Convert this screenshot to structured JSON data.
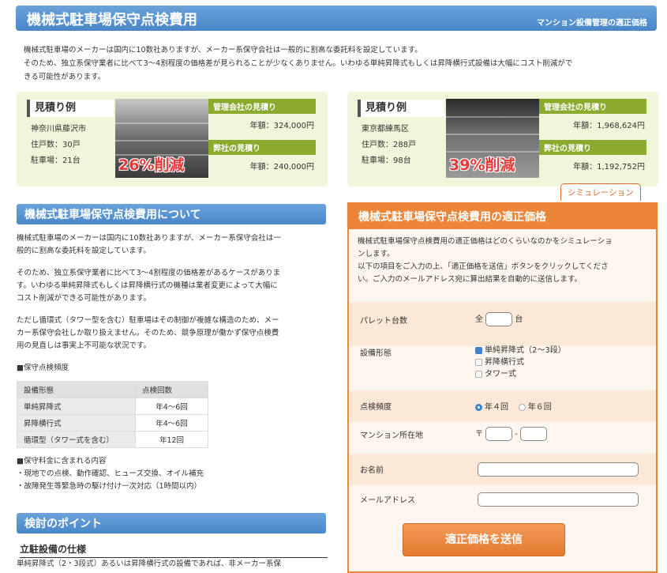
{
  "header": {
    "title": "機械式駐車場保守点検費用",
    "tag": "マンション設備管理の適正価格"
  },
  "intro": {
    "line1": "機械式駐車場のメーカーは国内に10数社ありますが、メーカー系保守会社は一般的に割高な委託料を設定しています。",
    "line2": "そのため、独立系保守業者に比べて3～4割程度の価格差が見られることが少なくありません。いわゆる単純昇降式もしくは昇降横行式設備は大幅にコスト削減がで",
    "line3": "きる可能性があります。"
  },
  "estimates": [
    {
      "label": "見積り例",
      "location": "神奈川県藤沢市",
      "units": "住戸数：30戸",
      "parking": "駐車場：21台",
      "cut": "26%削減",
      "mgmt_tag": "管理会社の見積り",
      "mgmt_amount": "年額：324,000円",
      "ours_tag": "弊社の見積り",
      "ours_amount": "年額：240,000円"
    },
    {
      "label": "見積り例",
      "location": "東京都練馬区",
      "units": "住戸数：288戸",
      "parking": "駐車場：98台",
      "cut": "39%削減",
      "mgmt_tag": "管理会社の見積り",
      "mgmt_amount": "年額：1,968,624円",
      "ours_tag": "弊社の見積り",
      "ours_amount": "年額：1,192,752円"
    }
  ],
  "about": {
    "title": "機械式駐車場保守点検費用について",
    "p1a": "機械式駐車場のメーカーは国内に10数社ありますが、メーカー系保守会社は一",
    "p1b": "般的に割高な委託料を設定しています。",
    "p2a": "そのため、独立系保守業者に比べて3～4割程度の価格差があるケースがありま",
    "p2b": "す。いわゆる単純昇降式もしくは昇降横行式の機種は業者変更によって大幅に",
    "p2c": "コスト削減ができる可能性があります。",
    "p3a": "ただし循環式（タワー型を含む）駐車場はその制御が複雑な構造のため、メー",
    "p3b": "カー系保守会社しか取り扱えません。そのため、競争原理が働かず保守点検費",
    "p3c": "用の見直しは事実上不可能な状況です。",
    "freq_heading": "■保守点検頻度",
    "table_headers": [
      "設備形態",
      "点検回数"
    ],
    "table_rows": [
      [
        "単純昇降式",
        "年4～6回"
      ],
      [
        "昇降横行式",
        "年4～6回"
      ],
      [
        "循環型（タワー式を含む）",
        "年12回"
      ]
    ],
    "includes_heading": "■保守料金に含まれる内容",
    "include1": "・現地での点検、動作確認、ヒューズ交換、オイル補充",
    "include2": "・故障発生等緊急時の駆け付け一次対応（1時間以内）"
  },
  "points": {
    "title": "検討のポイント",
    "subtitle": "立駐設備の仕様",
    "text": "単純昇降式（2・3段式）あるいは昇降横行式の設備であれば、非メーカー系保"
  },
  "simulation": {
    "tab": "シミュレーション",
    "title": "機械式駐車場保守点検費用の適正価格",
    "desc1": "機械式駐車場保守点検費用の適正価格はどのくらいなのかをシミュレーショ",
    "desc2": "ンします。",
    "desc3": "以下の項目をご入力の上、「適正価格を送信」ボタンをクリックしてくださ",
    "desc4": "い。ご入力のメールアドレス宛に算出結果を自動的に送信します。",
    "pallet_label": "パレット台数",
    "pallet_prefix": "全",
    "pallet_suffix": "台",
    "equip_label": "設備形態",
    "equip_options": [
      "単純昇降式（2～3段）",
      "昇降横行式",
      "タワー式"
    ],
    "freq_label": "点検頻度",
    "freq_options": [
      "年４回",
      "年６回"
    ],
    "zip_label": "マンション所在地",
    "zip_prefix": "〒",
    "zip_sep": "-",
    "name_label": "お名前",
    "email_label": "メールアドレス",
    "submit": "適正価格を送信"
  }
}
